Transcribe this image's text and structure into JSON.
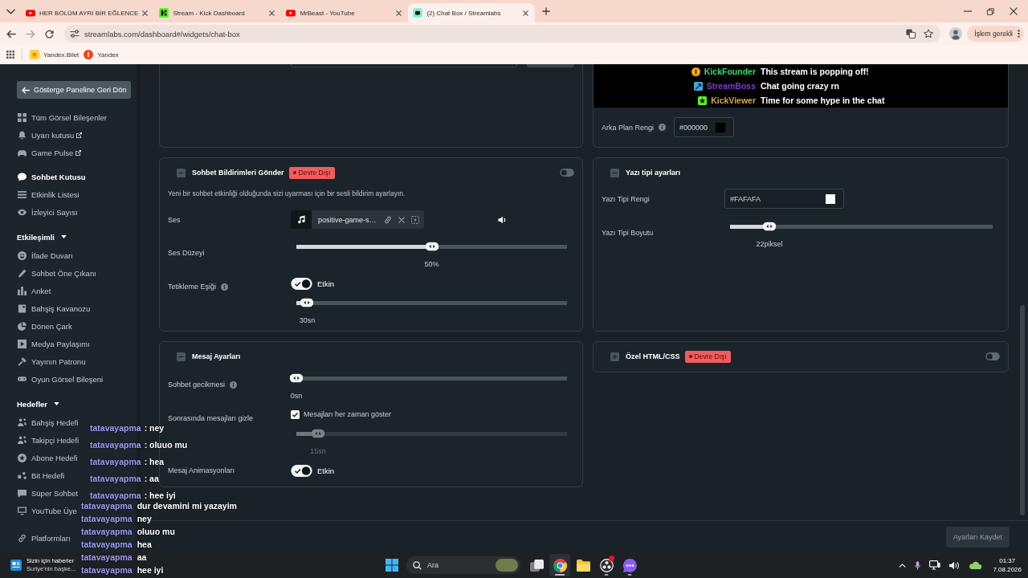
{
  "browser": {
    "tabs": [
      {
        "title": "HER BÖLÜM AYRI BİR EĞLENCE",
        "selected": false
      },
      {
        "title": "Stream - Kick Dashboard",
        "selected": false
      },
      {
        "title": "MrBeast - YouTube",
        "selected": false
      },
      {
        "title": "(2) Chat Box / Streamlabs",
        "selected": true
      }
    ],
    "url": "streamlabs.com/dashboard#/widgets/chat-box",
    "profile_button": "İşlem gerekli",
    "bookmarks": [
      {
        "label": "Yandex.Bilet"
      },
      {
        "label": "Yandex"
      }
    ]
  },
  "sidebar": {
    "back_button": "Gösterge Paneline Geri Dön",
    "groups": [
      {
        "items": [
          {
            "label": "Tüm Görsel Bileşenler",
            "external": false,
            "selected": false
          },
          {
            "label": "Uyarı kutusu",
            "external": true,
            "selected": false
          },
          {
            "label": "Game Pulse",
            "external": true,
            "selected": false
          }
        ]
      },
      {
        "items": [
          {
            "label": "Sohbet Kutusu",
            "external": false,
            "selected": true
          },
          {
            "label": "Etkinlik Listesi",
            "external": false,
            "selected": false
          },
          {
            "label": "İzleyici Sayısı",
            "external": false,
            "selected": false
          }
        ]
      },
      {
        "title": "Etkileşimli",
        "expanded": true,
        "items": [
          {
            "label": "İfade Duvarı",
            "external": false,
            "selected": false
          },
          {
            "label": "Sohbet Öne Çıkanı",
            "external": false,
            "selected": false
          },
          {
            "label": "Anket",
            "external": false,
            "selected": false
          },
          {
            "label": "Bahşiş Kavanozu",
            "external": false,
            "selected": false
          },
          {
            "label": "Dönen Çark",
            "external": false,
            "selected": false
          },
          {
            "label": "Medya Paylaşımı",
            "external": false,
            "selected": false
          },
          {
            "label": "Yayının Patronu",
            "external": false,
            "selected": false
          },
          {
            "label": "Oyun Görsel Bileşeni",
            "external": false,
            "selected": false
          }
        ]
      },
      {
        "title": "Hedefler",
        "expanded": true,
        "items": [
          {
            "label": "Bahşiş Hedefi",
            "external": false,
            "selected": false
          },
          {
            "label": "Takipçi Hedefi",
            "external": false,
            "selected": false
          },
          {
            "label": "Abone Hedefi",
            "external": false,
            "selected": false
          },
          {
            "label": "Bit Hedefi",
            "external": false,
            "selected": false
          },
          {
            "label": "Süper Sohbet",
            "external": false,
            "selected": false
          },
          {
            "label": "YouTube Üye",
            "external": false,
            "selected": false
          }
        ]
      },
      {
        "items": [
          {
            "label": "Platformları",
            "external": false,
            "selected": false
          }
        ]
      }
    ]
  },
  "settings": {
    "columns": [
      {
        "panels": [
          {
            "kind": "clipped"
          },
          {
            "kind": "section",
            "title": "Sohbet Bildirimleri Gönder",
            "collapsed": false,
            "status": "Devre Dışı",
            "enabled": false,
            "description": "Yeni bir sohbet etkinliği olduğunda sizi uyarması için bir sesli bildirim ayarlayın.",
            "rows": [
              {
                "kind": "sound",
                "label": "Ses",
                "info": false,
                "file": "positive-game-s…"
              },
              {
                "kind": "slider",
                "label": "Ses Düzeyi",
                "info": false,
                "disabled": false,
                "level": 0.5,
                "reading": "50%"
              },
              {
                "kind": "toggle_slider",
                "label": "Tetikleme Eşiği",
                "info": true,
                "on": true,
                "toggle_label": "Etkin",
                "disabled": false,
                "level": 0.04,
                "reading": "30sn"
              }
            ]
          },
          {
            "kind": "section",
            "title": "Mesaj Ayarları",
            "collapsed": false,
            "rows": [
              {
                "kind": "slider",
                "label": "Sohbet gecikmesi",
                "info": true,
                "disabled": false,
                "level": 0,
                "reading": "0sn"
              },
              {
                "kind": "check_slider",
                "label": "Sonrasında mesajları gizle",
                "info": false,
                "checked": true,
                "check_label": "Mesajları her zaman göster",
                "disabled": true,
                "level": 0.08,
                "reading": "15sn"
              },
              {
                "kind": "toggle",
                "label": "Mesaj Animasyonları",
                "info": false,
                "on": true,
                "toggle_label": "Etkin"
              }
            ]
          }
        ]
      },
      {
        "panels": [
          {
            "kind": "preview",
            "messages": [
              {
                "user": "KickFounder",
                "color": "#34dc6c",
                "text": "This stream is popping off!"
              },
              {
                "user": "StreamBoss",
                "color": "#7a3cc8",
                "text": "Chat going crazy rn"
              },
              {
                "user": "KickViewer",
                "color": "#d2aa48",
                "text": "Time for some hype in the chat"
              }
            ],
            "rows": [
              {
                "kind": "color",
                "label": "Arka Plan Rengi",
                "info": true,
                "value": "#000000",
                "color": "#000000"
              }
            ]
          },
          {
            "kind": "section",
            "title": "Yazı tipi ayarları",
            "collapsed": false,
            "rows": [
              {
                "kind": "color",
                "label": "Yazı Tipi Rengi",
                "info": false,
                "value": "#FAFAFA",
                "color": "#fafafa"
              },
              {
                "kind": "slider",
                "label": "Yazı Tipi Boyutu",
                "info": false,
                "disabled": false,
                "level": 0.15,
                "reading": "22piksel"
              }
            ]
          },
          {
            "kind": "section",
            "title": "Özel HTML/CSS",
            "collapsed": true,
            "status": "Devre Dışı",
            "enabled": false
          }
        ]
      }
    ]
  },
  "footer": {
    "save_button": {
      "label": "Ayarları Kaydet",
      "disabled": true
    }
  },
  "taskbar": {
    "news": {
      "title": "Sizin için haberler",
      "headline": "Suriye'nin başke..."
    },
    "search": {
      "placeholder": "Ara"
    },
    "apps": [
      {
        "open": false,
        "selected": false,
        "badge": false
      },
      {
        "open": true,
        "selected": true,
        "badge": false
      },
      {
        "open": false,
        "selected": false,
        "badge": false
      },
      {
        "open": true,
        "selected": false,
        "badge": true
      },
      {
        "open": true,
        "selected": false,
        "badge": false
      }
    ],
    "time": "01:37",
    "date": "7.08.2026"
  },
  "chat_overlays": [
    {
      "messages": [
        {
          "user": "tatavayapma",
          "text": ": ney"
        },
        {
          "user": "tatavayapma",
          "text": ": oluuo mu"
        },
        {
          "user": "tatavayapma",
          "text": ": hea"
        },
        {
          "user": "tatavayapma",
          "text": ": aa"
        },
        {
          "user": "tatavayapma",
          "text": ": hee iyi"
        }
      ]
    },
    {
      "messages": [
        {
          "user": "tatavayapma",
          "text": "dur devamini mi yazayim"
        },
        {
          "user": "tatavayapma",
          "text": "ney"
        },
        {
          "user": "tatavayapma",
          "text": "oluuo mu"
        },
        {
          "user": "tatavayapma",
          "text": "hea"
        },
        {
          "user": "tatavayapma",
          "text": "aa"
        },
        {
          "user": "tatavayapma",
          "text": "hee iyi"
        }
      ]
    }
  ]
}
